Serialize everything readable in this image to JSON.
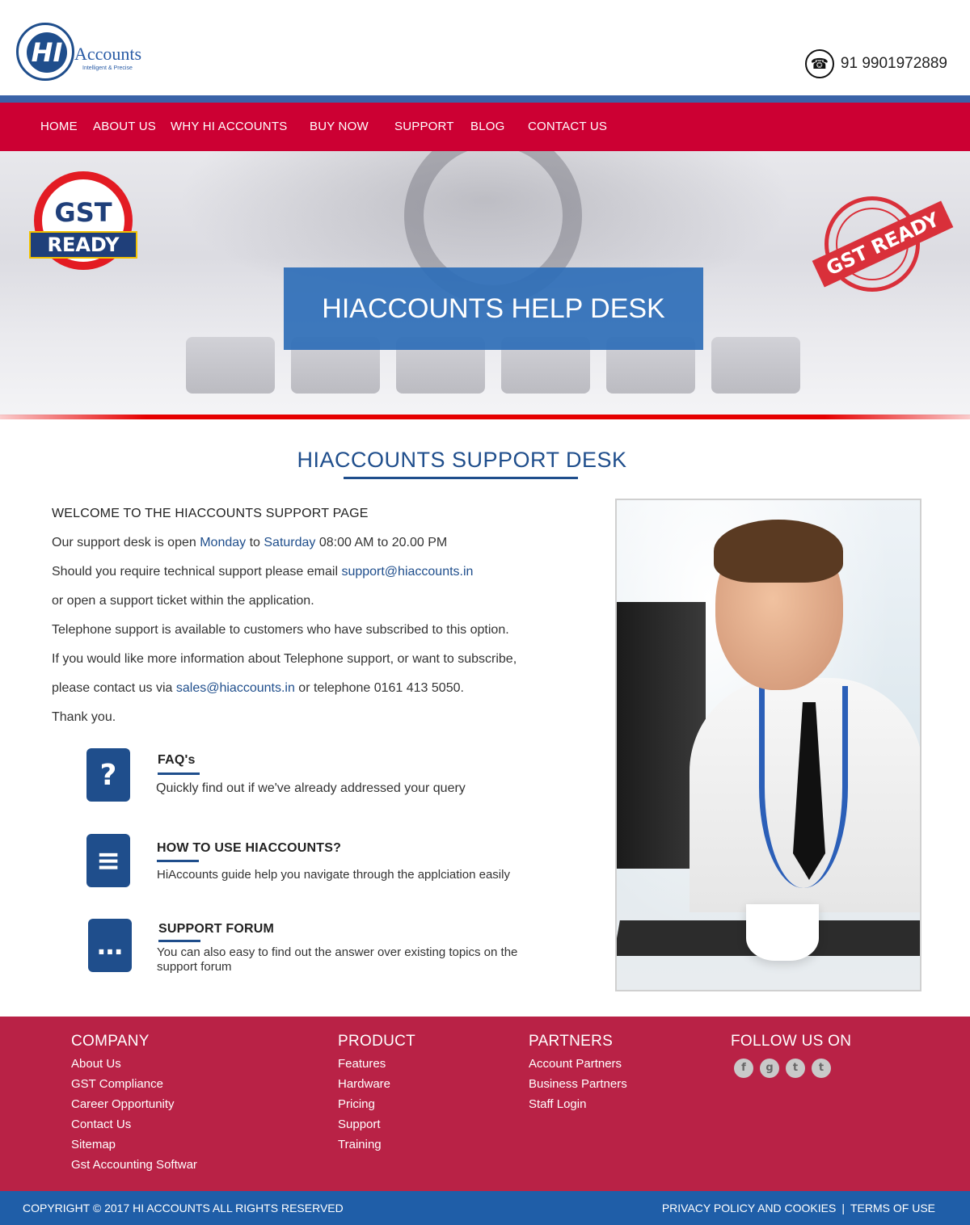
{
  "header": {
    "logo_word": "Accounts",
    "logo_tagline": "Intelligent & Precise",
    "logo_mark": "HI",
    "phone": "91 9901972889",
    "phone_icon": "phone-icon"
  },
  "nav": {
    "items": [
      {
        "label": "HOME"
      },
      {
        "label": "ABOUT US"
      },
      {
        "label": "WHY HI ACCOUNTS"
      },
      {
        "label": "BUY NOW"
      },
      {
        "label": "SUPPORT"
      },
      {
        "label": "BLOG"
      },
      {
        "label": "CONTACT US"
      }
    ]
  },
  "hero": {
    "title": "HIACCOUNTS HELP DESK",
    "badge_left": {
      "line1": "GST",
      "line2": "READY"
    },
    "badge_right": {
      "text": "GST READY"
    }
  },
  "support": {
    "section_title": "HIACCOUNTS SUPPORT DESK",
    "welcome": "WELCOME TO THE HIACCOUNTS SUPPORT PAGE",
    "line1_prefix": "Our  support desk is open ",
    "day_from": "Monday",
    "line1_mid": " to ",
    "day_to": "Saturday",
    "line1_suffix": " 08:00 AM to 20.00 PM",
    "line2_prefix": "Should you require technical support please email ",
    "support_email": "support@hiaccounts.in",
    "line3": "or open a support ticket within the application.",
    "line4": "Telephone support is available to customers who have subscribed to this option.",
    "line5": "If you would like more information about Telephone support, or want to subscribe,",
    "line6_prefix": "please contact us via ",
    "sales_email": "sales@hiaccounts.in",
    "line6_suffix": " or telephone 0161 413 5050.",
    "thanks": "Thank you."
  },
  "features": [
    {
      "icon": "question-icon",
      "glyph": "?",
      "title": "FAQ's",
      "desc": "Quickly find out if we've already addressed  your query"
    },
    {
      "icon": "guide-book-icon",
      "glyph": "≡",
      "title": "HOW TO USE HIACCOUNTS?",
      "desc": "HiAccounts guide help you navigate through the applciation easily"
    },
    {
      "icon": "chat-bubbles-icon",
      "glyph": "…",
      "title": "SUPPORT FORUM",
      "desc": "You can also easy to find out the answer over existing topics on the support forum"
    }
  ],
  "footer": {
    "company": {
      "heading": "COMPANY",
      "links": [
        "About Us",
        "GST Compliance",
        "Career Opportunity",
        "Contact Us",
        "Sitemap",
        "Gst Accounting Softwar"
      ]
    },
    "product": {
      "heading": "PRODUCT",
      "links": [
        "Features",
        "Hardware",
        "Pricing",
        "Support",
        "Training"
      ]
    },
    "partners": {
      "heading": "PARTNERS",
      "links": [
        "Account Partners",
        "Business Partners",
        "Staff Login"
      ]
    },
    "follow": {
      "heading": "FOLLOW US ON",
      "icons": [
        {
          "name": "facebook-icon",
          "glyph": "f"
        },
        {
          "name": "google-plus-icon",
          "glyph": "g"
        },
        {
          "name": "twitter-icon",
          "glyph": "t"
        },
        {
          "name": "tumblr-icon",
          "glyph": "t"
        }
      ]
    }
  },
  "bottom": {
    "copyright": "COPYRIGHT © 2017 HI ACCOUNTS ALL RIGHTS RESERVED",
    "privacy": "PRIVACY POLICY AND COOKIES",
    "separator": "|",
    "terms": "TERMS OF USE"
  },
  "colors": {
    "nav_red": "#cc0033",
    "brand_blue": "#1f4e8c",
    "footer_red": "#b92246",
    "bottom_blue": "#1f5ea8"
  }
}
